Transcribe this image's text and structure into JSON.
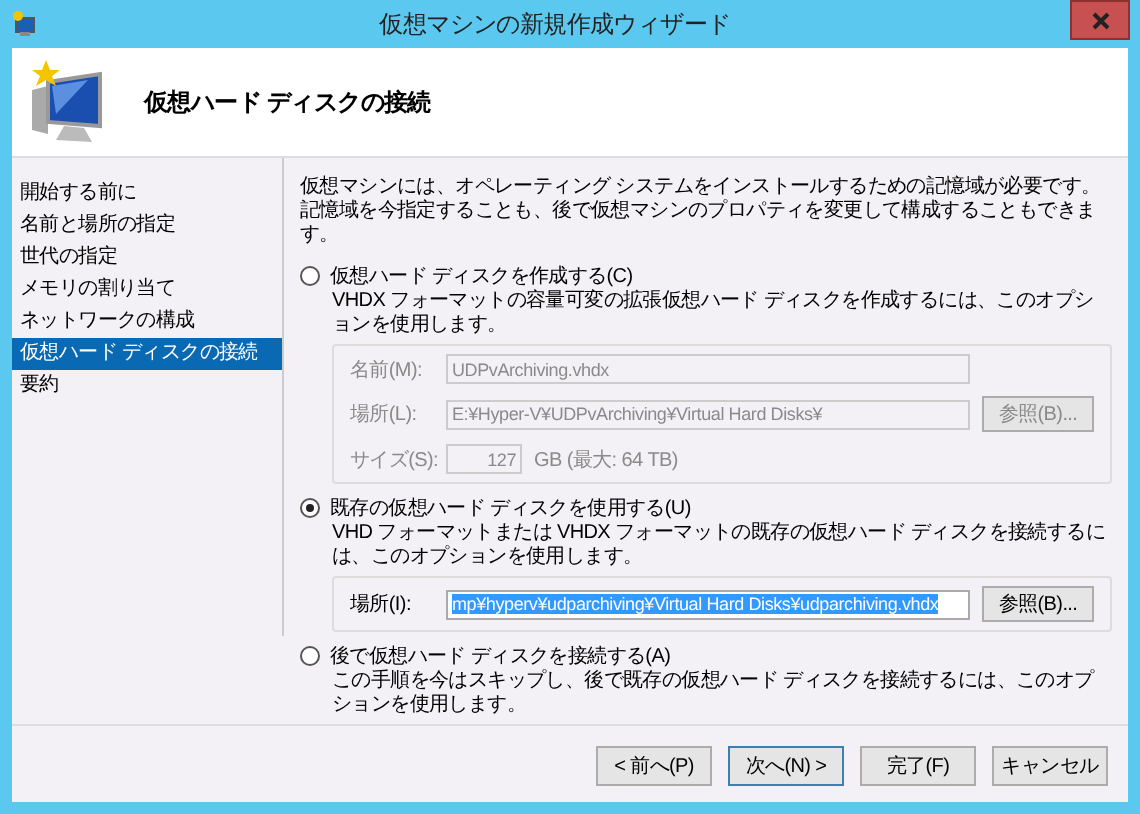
{
  "window": {
    "title": "仮想マシンの新規作成ウィザード"
  },
  "header": {
    "title": "仮想ハード ディスクの接続"
  },
  "sidebar": {
    "items": [
      {
        "label": "開始する前に",
        "selected": false
      },
      {
        "label": "名前と場所の指定",
        "selected": false
      },
      {
        "label": "世代の指定",
        "selected": false
      },
      {
        "label": "メモリの割り当て",
        "selected": false
      },
      {
        "label": "ネットワークの構成",
        "selected": false
      },
      {
        "label": "仮想ハード ディスクの接続",
        "selected": true
      },
      {
        "label": "要約",
        "selected": false
      }
    ]
  },
  "intro": "仮想マシンには、オペレーティング システムをインストールするための記憶域が必要です。記憶域を今指定することも、後で仮想マシンのプロパティを変更して構成することもできます。",
  "options": [
    {
      "label": "仮想ハード ディスクを作成する(C)",
      "selected": false,
      "description": "VHDX フォーマットの容量可変の拡張仮想ハード ディスクを作成するには、このオプションを使用します。",
      "disabled": true,
      "fields": [
        {
          "kind": "text",
          "label": "名前(M):",
          "value": "UDPvArchiving.vhdx"
        },
        {
          "kind": "browse",
          "label": "場所(L):",
          "value": "E:¥Hyper-V¥UDPvArchiving¥Virtual Hard Disks¥",
          "button": "参照(B)..."
        },
        {
          "kind": "size",
          "label": "サイズ(S):",
          "value": "127",
          "unit": "GB (最大: 64 TB)"
        }
      ]
    },
    {
      "label": "既存の仮想ハード ディスクを使用する(U)",
      "selected": true,
      "description": "VHD フォーマットまたは VHDX フォーマットの既存の仮想ハード ディスクを接続するには、このオプションを使用します。",
      "disabled": false,
      "fields": [
        {
          "kind": "browse",
          "label": "場所(I):",
          "value": "mp¥hyperv¥udparchiving¥Virtual Hard Disks¥udparchiving.vhdx",
          "value_selected": true,
          "button": "参照(B)..."
        }
      ]
    },
    {
      "label": "後で仮想ハード ディスクを接続する(A)",
      "selected": false,
      "description": "この手順を今はスキップし、後で既存の仮想ハード ディスクを接続するには、このオプションを使用します。"
    }
  ],
  "buttons": [
    {
      "label": "< 前へ(P)",
      "default": false
    },
    {
      "label": "次へ(N) >",
      "default": true
    },
    {
      "label": "完了(F)",
      "default": false
    },
    {
      "label": "キャンセル",
      "default": false
    }
  ]
}
